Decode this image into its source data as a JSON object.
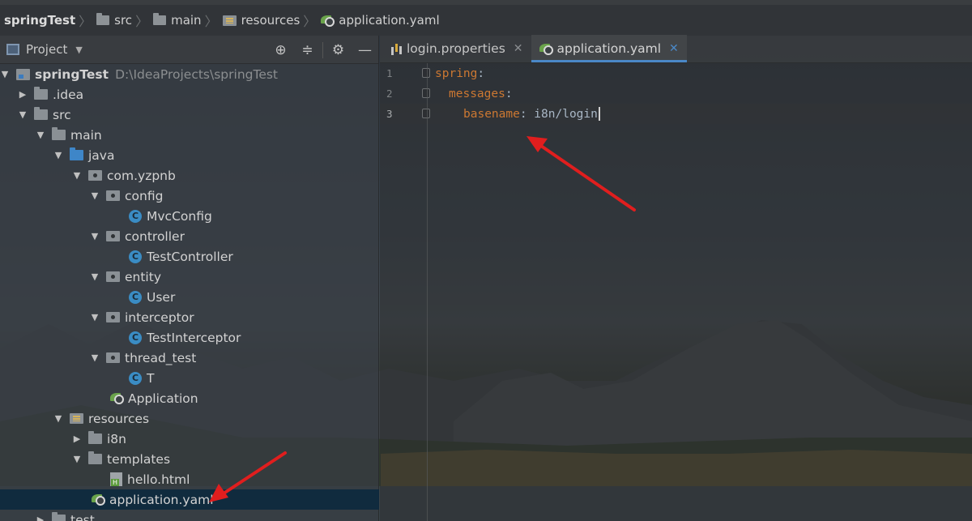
{
  "breadcrumb": {
    "project": "springTest",
    "items": [
      "src",
      "main",
      "resources",
      "application.yaml"
    ]
  },
  "project_panel": {
    "title": "Project",
    "tools": [
      "crosshair-icon",
      "collapse-icon",
      "gear-icon",
      "minimize-icon"
    ]
  },
  "tree": {
    "root": {
      "label": "springTest",
      "path": "D:\\IdeaProjects\\springTest"
    },
    "idea": ".idea",
    "src": "src",
    "main": "main",
    "java": "java",
    "pkg": "com.yzpnb",
    "config": "config",
    "mvcconfig": "MvcConfig",
    "controller": "controller",
    "testcontroller": "TestController",
    "entity": "entity",
    "user": "User",
    "interceptor": "interceptor",
    "testinterceptor": "TestInterceptor",
    "thread_test": "thread_test",
    "t": "T",
    "application": "Application",
    "resources": "resources",
    "i18n": "i8n",
    "templates": "templates",
    "hello": "hello.html",
    "appyaml": "application.yaml",
    "test": "test"
  },
  "editor": {
    "tabs": [
      {
        "label": "login.properties",
        "active": false
      },
      {
        "label": "application.yaml",
        "active": true
      }
    ],
    "lines": [
      {
        "num": "1",
        "key": "spring",
        "sep": ":",
        "value": ""
      },
      {
        "num": "2",
        "key": "messages",
        "sep": ":",
        "value": ""
      },
      {
        "num": "3",
        "key": "basename",
        "sep": ":",
        "value": " i8n/login"
      }
    ]
  },
  "colors": {
    "yaml_key": "#cc7832",
    "selection": "#0d293e",
    "tab_underline": "#4a88c7",
    "annotation_arrow": "#e01e1e"
  }
}
